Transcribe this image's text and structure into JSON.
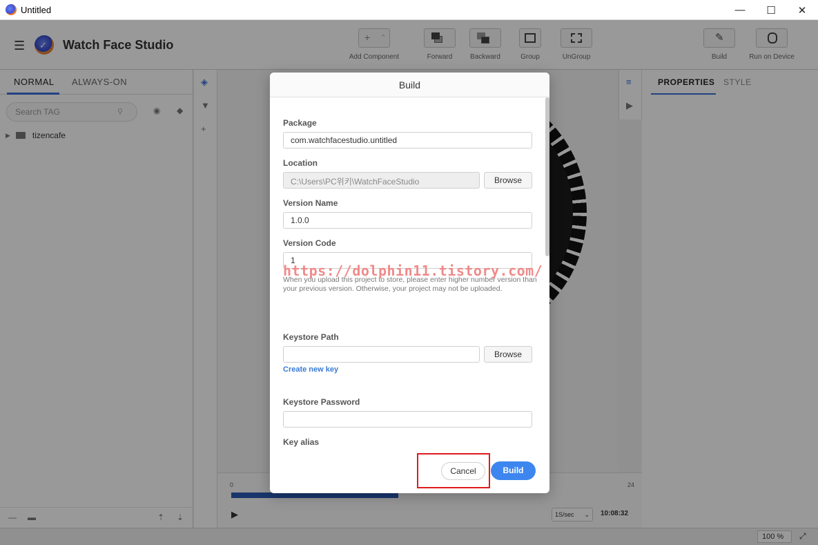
{
  "window": {
    "title": "Untitled",
    "minimize": "—",
    "maximize": "☐",
    "close": "✕"
  },
  "header": {
    "brand": "Watch Face Studio",
    "tools": {
      "add_component": "Add Component",
      "forward": "Forward",
      "backward": "Backward",
      "group": "Group",
      "ungroup": "UnGroup",
      "build": "Build",
      "run_on_device": "Run on Device"
    }
  },
  "left_panel": {
    "tabs": [
      "NORMAL",
      "ALWAYS-ON"
    ],
    "search_placeholder": "Search TAG",
    "tree": [
      {
        "label": "tizencafe"
      }
    ]
  },
  "right_panel": {
    "tabs": [
      "PROPERTIES",
      "STYLE"
    ]
  },
  "timeline": {
    "start": "0",
    "end": "24",
    "speed": "1S/sec",
    "time": "10:08:32",
    "progress": 0.42
  },
  "status": {
    "zoom": "100 %"
  },
  "dialog": {
    "title": "Build",
    "package_label": "Package",
    "package_value": "com.watchfacestudio.untitled",
    "location_label": "Location",
    "location_value": "C:\\Users\\PC위키\\WatchFaceStudio",
    "browse": "Browse",
    "version_name_label": "Version Name",
    "version_name_value": "1.0.0",
    "version_code_label": "Version Code",
    "version_code_value": "1",
    "version_hint": "When you upload this project to store, please enter higher number version than your previous version. Otherwise, your project may not be uploaded.",
    "keystore_path_label": "Keystore Path",
    "keystore_path_value": "",
    "create_new_key": "Create new key",
    "keystore_password_label": "Keystore Password",
    "keystore_password_value": "",
    "key_alias_label": "Key alias",
    "cancel": "Cancel",
    "build": "Build"
  },
  "watermark": "https://dolphin11.tistory.com/",
  "colors": {
    "accent": "#3d86ef",
    "highlight": "#e01b1b",
    "timeline": "#2a5bb5"
  }
}
